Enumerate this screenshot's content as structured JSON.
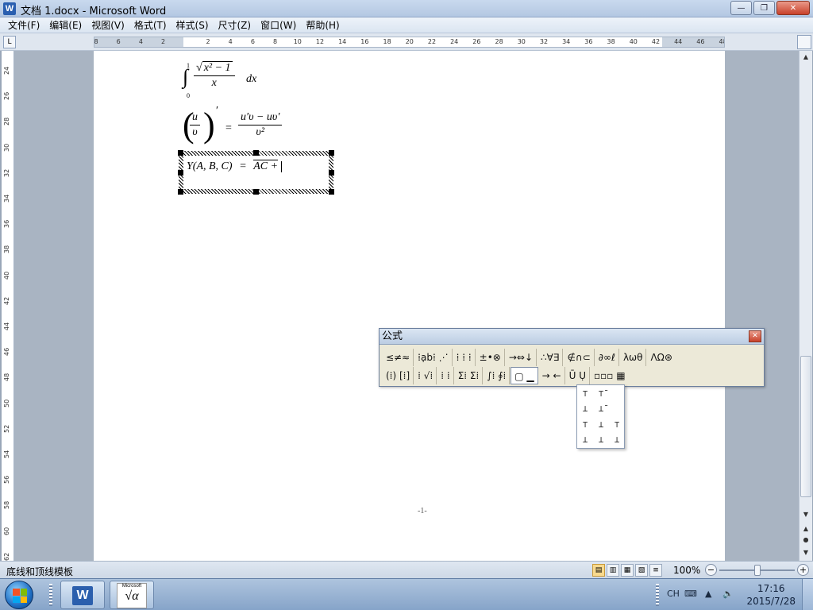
{
  "window": {
    "title": "文档 1.docx - Microsoft Word",
    "app_icon": "W",
    "buttons": {
      "minimize": "—",
      "restore": "❐",
      "close": "✕"
    }
  },
  "menu": [
    "文件(F)",
    "编辑(E)",
    "视图(V)",
    "格式(T)",
    "样式(S)",
    "尺寸(Z)",
    "窗口(W)",
    "帮助(H)"
  ],
  "ruler": {
    "corner": "L",
    "ticks": [
      "8",
      "6",
      "4",
      "2",
      "",
      "2",
      "4",
      "6",
      "8",
      "10",
      "12",
      "14",
      "16",
      "18",
      "20",
      "22",
      "24",
      "26",
      "28",
      "30",
      "32",
      "34",
      "36",
      "38",
      "40",
      "42",
      "44",
      "46",
      "48"
    ],
    "vticks": [
      "24",
      "26",
      "28",
      "30",
      "32",
      "34",
      "36",
      "38",
      "40",
      "42",
      "44",
      "46",
      "48",
      "50",
      "52",
      "54",
      "56",
      "58",
      "60",
      "62"
    ]
  },
  "equations": {
    "eq1": {
      "integral": "∫",
      "upper": "1",
      "lower": "0",
      "radicand": "x² − 1",
      "sqrt": "√",
      "denominator": "x",
      "tail": "dx"
    },
    "eq2": {
      "num_inner": "u",
      "den_inner": "υ",
      "prime": "′",
      "equals": "=",
      "num": "u′υ − uυ′",
      "den": "υ²"
    },
    "eq3": {
      "lhs": "Y(A, B, C)",
      "equals": "=",
      "rhs": "AC +"
    }
  },
  "page_number": "-1-",
  "formula_toolbar": {
    "title": "公式",
    "close": "✕",
    "row1": [
      "≤≠≈",
      "⁞ạb⁞ ⋰",
      "⁞ ⁞ ⁞",
      "±•⊗",
      "→⇔↓",
      "∴∀∃",
      "∉∩⊂",
      "∂∞ℓ",
      "λωθ",
      "ΛΩ⊛"
    ],
    "row2": [
      "(⁞) [⁞]",
      "⁞ √⁞",
      "⁞ ⁞",
      "Σ⁞ Σ⁞",
      "∫⁞ ∮⁞",
      "▢ ▁",
      "→ ←",
      "Ū Ụ",
      "▫▫▫ ▦"
    ]
  },
  "palette": {
    "cells": [
      "⊤",
      "⊤̄",
      "⊥",
      "⊥̄",
      "⊤",
      "⊥",
      "⊤",
      "⊥",
      "⊥",
      "⊥"
    ]
  },
  "status": {
    "text": "底线和顶线模板",
    "zoom": "100%",
    "view_icons": [
      "▤",
      "▥",
      "▦",
      "▧",
      "≡"
    ],
    "zoom_minus": "−",
    "zoom_plus": "+"
  },
  "taskbar": {
    "word_icon": "W",
    "mt_top": "Microsoft",
    "mt_main": "√α",
    "tray_lang": "CH",
    "time": "17:16",
    "date": "2015/7/28"
  },
  "scroll": {
    "up": "▲",
    "down": "▼",
    "prev": "●",
    "next": "▼"
  }
}
